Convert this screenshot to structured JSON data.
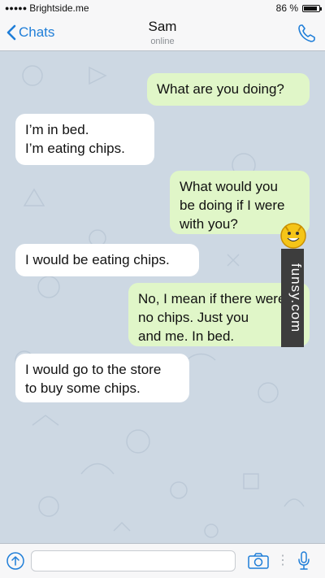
{
  "status_bar": {
    "carrier": "Brightside.me",
    "battery": "86 %"
  },
  "header": {
    "back_label": "Chats",
    "contact_name": "Sam",
    "contact_status": "online"
  },
  "messages": [
    {
      "direction": "out",
      "text": "What are you doing?"
    },
    {
      "direction": "in",
      "text": "I’m in bed.\nI’m eating chips."
    },
    {
      "direction": "out",
      "text": "What would you\nbe doing if I were\nwith you?"
    },
    {
      "direction": "in",
      "text": "I would be eating chips."
    },
    {
      "direction": "out",
      "text": "No, I mean if there were\nno chips. Just you\nand me. In bed."
    },
    {
      "direction": "in",
      "text": "I would go to the store\nto buy some chips."
    }
  ],
  "watermark": {
    "text": "funsy.com"
  },
  "composer": {
    "placeholder": ""
  },
  "colors": {
    "accent": "#1f7ed8",
    "incoming_bubble": "#ffffff",
    "outgoing_bubble": "#e0f6c8",
    "chat_background": "#cdd8e3"
  },
  "icons": [
    "back-chevron-icon",
    "phone-icon",
    "attach-icon",
    "camera-icon",
    "microphone-icon"
  ]
}
